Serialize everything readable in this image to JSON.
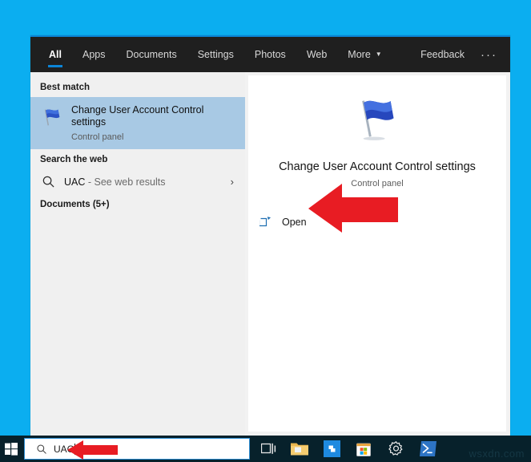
{
  "desktop": {
    "background_color": "#0baef0"
  },
  "search_panel": {
    "tabs": [
      {
        "label": "All",
        "active": true
      },
      {
        "label": "Apps",
        "active": false
      },
      {
        "label": "Documents",
        "active": false
      },
      {
        "label": "Settings",
        "active": false
      },
      {
        "label": "Photos",
        "active": false
      },
      {
        "label": "Web",
        "active": false
      },
      {
        "label": "More",
        "active": false,
        "has_caret": true
      }
    ],
    "feedback_label": "Feedback",
    "more_options_label": "···",
    "accent_color": "#0b84d6",
    "selection_color": "#a8c9e4",
    "results": {
      "best_match_header": "Best match",
      "best_match": {
        "title": "Change User Account Control settings",
        "subtitle": "Control panel",
        "icon": "blue-flag-icon",
        "selected": true
      },
      "search_web_header": "Search the web",
      "web_result": {
        "query": "UAC",
        "suffix": " - See web results",
        "icon": "search-icon",
        "chevron": "›"
      },
      "documents_header": "Documents (5+)"
    },
    "preview": {
      "icon": "blue-flag-icon",
      "title": "Change User Account Control settings",
      "subtitle": "Control panel",
      "open_label": "Open",
      "open_icon": "open-in-new-window-icon"
    }
  },
  "annotations": {
    "arrow_color": "#e81c23",
    "arrow_open_target": "Open",
    "arrow_searchbox_target": "UAC"
  },
  "taskbar": {
    "background_color": "#07212b",
    "start_button_icon": "windows-logo-icon",
    "search": {
      "value": "UAC",
      "icon": "search-icon",
      "border_color": "#2d8fd5"
    },
    "task_view_icon": "task-view-icon",
    "apps": [
      {
        "name": "file-explorer",
        "icon": "folder-icon"
      },
      {
        "name": "blue-app",
        "icon": "blue-app-icon"
      },
      {
        "name": "microsoft-store",
        "icon": "store-icon"
      },
      {
        "name": "settings",
        "icon": "gear-icon"
      },
      {
        "name": "windows-powershell",
        "icon": "powershell-icon"
      }
    ]
  },
  "watermark": {
    "text": "wsxdn.com"
  }
}
